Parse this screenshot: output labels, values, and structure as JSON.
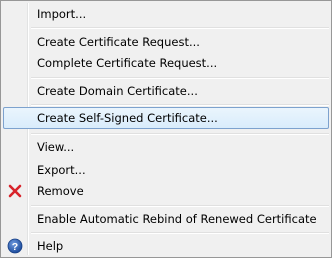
{
  "menu": {
    "items": [
      {
        "label": "Import..."
      },
      {
        "label": "Create Certificate Request..."
      },
      {
        "label": "Complete Certificate Request..."
      },
      {
        "label": "Create Domain Certificate..."
      },
      {
        "label": "Create Self-Signed Certificate..."
      },
      {
        "label": "View..."
      },
      {
        "label": "Export..."
      },
      {
        "label": "Remove",
        "icon": "red-x-icon"
      },
      {
        "label": "Enable Automatic Rebind of Renewed Certificate"
      },
      {
        "label": "Help",
        "icon": "help-icon"
      }
    ],
    "highlighted_item": "Create Self-Signed Certificate...",
    "colors": {
      "background": "#f0f0f0",
      "highlight_border": "#7da2ce",
      "remove_icon": "#d8232a",
      "help_icon": "#2a5fb0"
    }
  }
}
